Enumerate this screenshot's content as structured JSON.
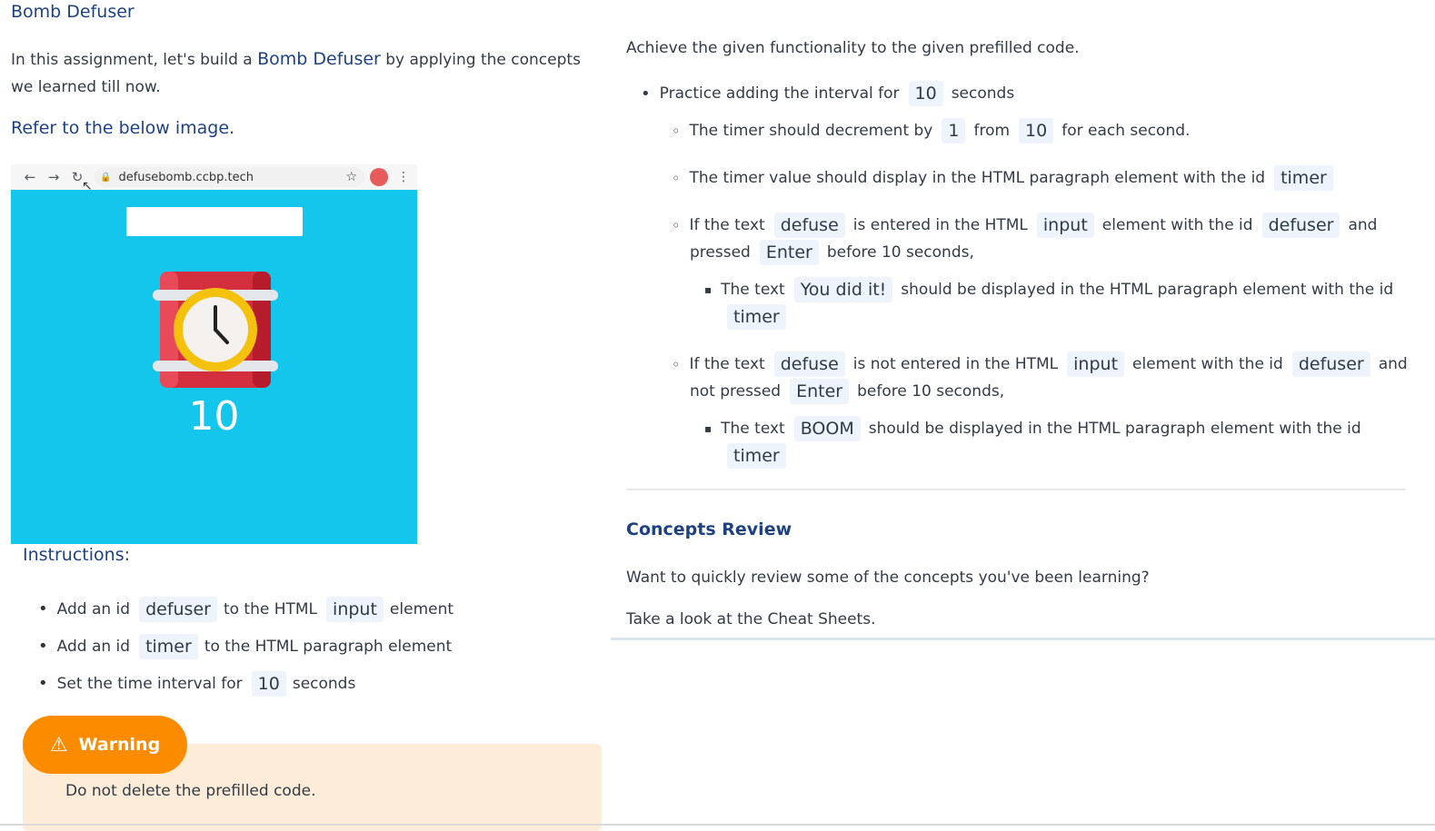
{
  "title": "Bomb Defuser",
  "intro": {
    "before": "In this assignment, let's build a",
    "highlight": "Bomb Defuser",
    "after": "by applying the concepts we learned till now."
  },
  "refer": "Refer to the below image.",
  "preview": {
    "url": "defusebomb.ccbp.tech",
    "timer": "10"
  },
  "instructions": {
    "title": "Instructions",
    "colon": ":",
    "items": [
      {
        "a": "Add an id",
        "c1": "defuser",
        "b": "to the HTML",
        "c2": "input",
        "d": "element"
      },
      {
        "a": "Add an id",
        "c1": "timer",
        "b": "to the HTML paragraph element"
      },
      {
        "a": "Set the time interval for",
        "c1": "10",
        "b": "seconds"
      }
    ]
  },
  "warning": {
    "label": "Warning",
    "text": "Do not delete the prefilled code."
  },
  "right": {
    "achieve": "Achieve the given functionality to the given prefilled code.",
    "l1": {
      "a": "Practice adding the interval for",
      "c": "10",
      "b": "seconds"
    },
    "l2": {
      "a": "The timer should decrement by",
      "c1": "1",
      "b": "from",
      "c2": "10",
      "d": "for each second."
    },
    "l3": {
      "a": "The timer value should display in the HTML paragraph element with the id",
      "c": "timer"
    },
    "l4": {
      "a": "If the text",
      "c1": "defuse",
      "b": "is entered in the HTML",
      "c2": "input",
      "d": "element with the id",
      "c3": "defuser",
      "e": "and"
    },
    "l4b": {
      "a": "pressed",
      "c": "Enter",
      "b": "before 10 seconds,"
    },
    "l5": {
      "a": "The text",
      "c": "You did it!",
      "b": "should be displayed in the HTML paragraph element with the id"
    },
    "l5b": {
      "c": "timer"
    },
    "l6": {
      "a": "If the text",
      "c1": "defuse",
      "b": "is not entered in the HTML",
      "c2": "input",
      "d": "element with the id",
      "c3": "defuser",
      "e": "and"
    },
    "l6b": {
      "a": "not pressed",
      "c": "Enter",
      "b": "before 10 seconds,"
    },
    "l7": {
      "a": "The text",
      "c": "BOOM",
      "b": "should be displayed in the HTML paragraph element with the id"
    },
    "l7b": {
      "c": "timer"
    },
    "concepts": "Concepts Review",
    "review_q": "Want to quickly review some of the concepts you've been learning?",
    "cheat": "Take a look at the Cheat Sheets."
  },
  "colors": {
    "heading": "#1e4281",
    "code_bg": "#eef4fb",
    "preview_bg": "#14c5ec",
    "warning_badge": "#fb8c00",
    "warning_bg": "#fdecd8"
  }
}
